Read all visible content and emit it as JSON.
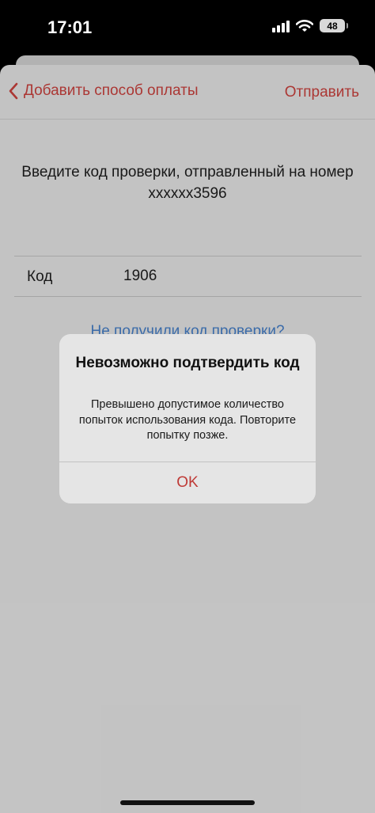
{
  "status_bar": {
    "time": "17:01",
    "battery_level": "48"
  },
  "nav": {
    "back_label": "Добавить способ оплаты",
    "action_label": "Отправить",
    "accent_color": "#b23a36"
  },
  "content": {
    "prompt": "Введите код проверки, отправленный на номер xxxxxx3596",
    "code_label": "Код",
    "code_value": "1906",
    "resend_link": "Не получили код проверки?"
  },
  "alert": {
    "title": "Невозможно подтвердить код",
    "message": "Превышено допустимое количество попыток использования кода. Повторите попытку позже.",
    "ok_label": "OK"
  }
}
